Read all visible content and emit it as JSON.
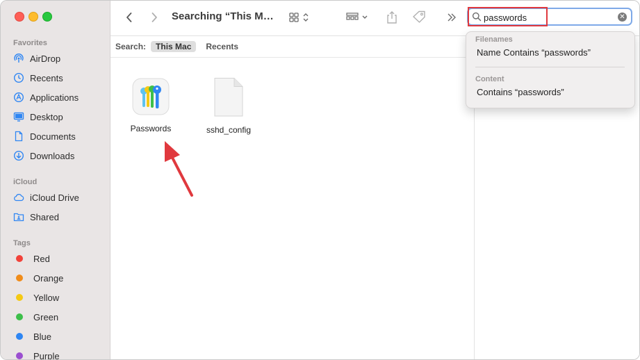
{
  "toolbar": {
    "title": "Searching “This M…",
    "search_value": "passwords"
  },
  "sidebar": {
    "sections": {
      "favorites": "Favorites",
      "icloud": "iCloud",
      "tags": "Tags"
    },
    "favorites": [
      {
        "label": "AirDrop",
        "icon": "airdrop-icon"
      },
      {
        "label": "Recents",
        "icon": "clock-icon"
      },
      {
        "label": "Applications",
        "icon": "applications-icon"
      },
      {
        "label": "Desktop",
        "icon": "desktop-icon"
      },
      {
        "label": "Documents",
        "icon": "document-icon"
      },
      {
        "label": "Downloads",
        "icon": "download-icon"
      }
    ],
    "icloud": [
      {
        "label": "iCloud Drive",
        "icon": "cloud-icon"
      },
      {
        "label": "Shared",
        "icon": "shared-folder-icon"
      }
    ],
    "tags": [
      {
        "label": "Red",
        "color": "#f2423a"
      },
      {
        "label": "Orange",
        "color": "#f08c1a"
      },
      {
        "label": "Yellow",
        "color": "#f5c913"
      },
      {
        "label": "Green",
        "color": "#3dbf4a"
      },
      {
        "label": "Blue",
        "color": "#2f86f3"
      },
      {
        "label": "Purple",
        "color": "#9b4fd0"
      }
    ]
  },
  "scope": {
    "label": "Search:",
    "options": [
      "This Mac",
      "Recents"
    ],
    "selected": "This Mac"
  },
  "files": [
    {
      "name": "Passwords",
      "icon": "passwords-app-icon"
    },
    {
      "name": "sshd_config",
      "icon": "generic-document-icon"
    }
  ],
  "suggestions": {
    "filenames_header": "Filenames",
    "filenames_item": "Name Contains “passwords”",
    "content_header": "Content",
    "content_item": "Contains “passwords”"
  },
  "colors": {
    "accent": "#2f86f3",
    "highlight": "#e0393e",
    "sidebar_bg": "#e9e5e5"
  }
}
